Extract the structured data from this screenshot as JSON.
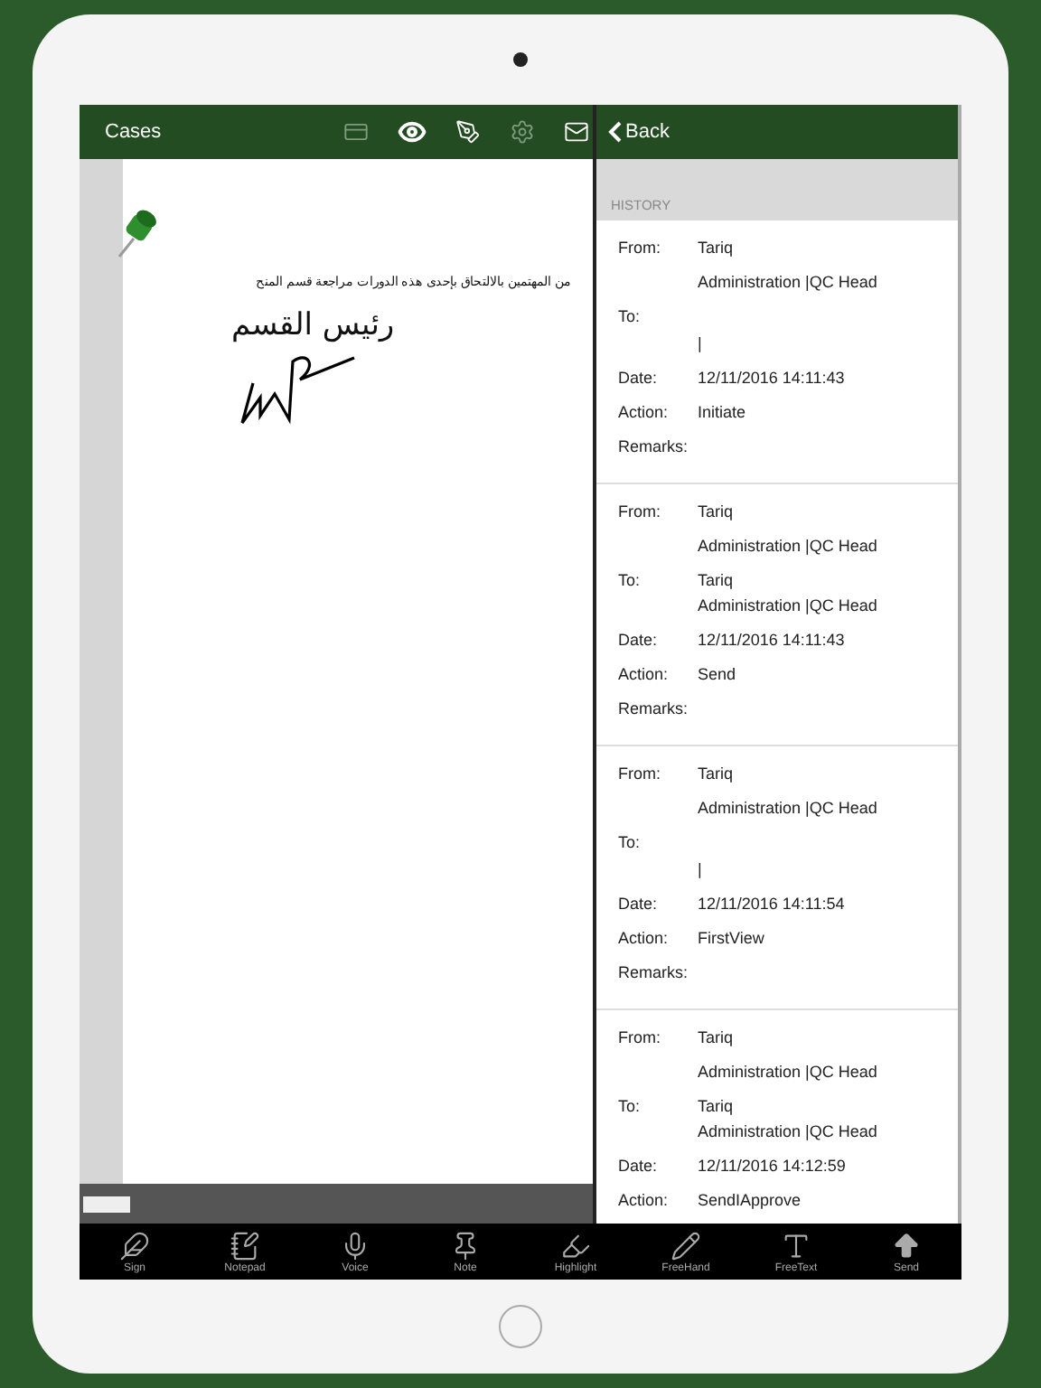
{
  "header": {
    "title": "Cases",
    "tools": [
      {
        "kind": "card",
        "disabled": true
      },
      {
        "kind": "eye",
        "disabled": false
      },
      {
        "kind": "pen",
        "disabled": false
      },
      {
        "kind": "gear",
        "disabled": true
      },
      {
        "kind": "mail",
        "disabled": false
      }
    ]
  },
  "document": {
    "lines": [
      {
        "kind": "small",
        "text": "من المهتمين بالالتحاق بإحدى هذه الدورات مراجعة قسم المنح"
      },
      {
        "kind": "large",
        "text": "رئيس القسم"
      }
    ]
  },
  "panel": {
    "back": "Back",
    "section": "HISTORY",
    "entries": [
      {
        "rows": [
          {
            "label": "From:",
            "kind": "inline",
            "lines": [
              "Tariq",
              "Administration |QC Head"
            ]
          },
          {
            "label": "To:",
            "kind": "below",
            "lines": [
              "|"
            ]
          },
          {
            "label": "Date:",
            "kind": "inline",
            "lines": [
              "12/11/2016 14:11:43"
            ]
          },
          {
            "label": "Action:",
            "kind": "inline",
            "lines": [
              "Initiate"
            ]
          },
          {
            "label": "Remarks:",
            "kind": "inline",
            "lines": []
          }
        ]
      },
      {
        "rows": [
          {
            "label": "From:",
            "kind": "inline",
            "lines": [
              "Tariq",
              "Administration |QC Head"
            ]
          },
          {
            "label": "To:",
            "kind": "tight",
            "lines": [
              "Tariq",
              "Administration |QC Head"
            ]
          },
          {
            "label": "Date:",
            "kind": "inline",
            "lines": [
              "12/11/2016 14:11:43"
            ]
          },
          {
            "label": "Action:",
            "kind": "inline",
            "lines": [
              "Send"
            ]
          },
          {
            "label": "Remarks:",
            "kind": "inline",
            "lines": []
          }
        ]
      },
      {
        "rows": [
          {
            "label": "From:",
            "kind": "inline",
            "lines": [
              "Tariq",
              "Administration |QC Head"
            ]
          },
          {
            "label": "To:",
            "kind": "below",
            "lines": [
              "|"
            ]
          },
          {
            "label": "Date:",
            "kind": "inline",
            "lines": [
              "12/11/2016 14:11:54"
            ]
          },
          {
            "label": "Action:",
            "kind": "inline",
            "lines": [
              "FirstView"
            ]
          },
          {
            "label": "Remarks:",
            "kind": "inline",
            "lines": []
          }
        ]
      },
      {
        "rows": [
          {
            "label": "From:",
            "kind": "inline",
            "lines": [
              "Tariq",
              "Administration |QC Head"
            ]
          },
          {
            "label": "To:",
            "kind": "tight",
            "lines": [
              "Tariq",
              "Administration |QC Head"
            ]
          },
          {
            "label": "Date:",
            "kind": "inline",
            "lines": [
              "12/11/2016 14:12:59"
            ]
          },
          {
            "label": "Action:",
            "kind": "inline",
            "lines": [
              "SendIApprove"
            ]
          }
        ]
      }
    ]
  },
  "toolbar": [
    {
      "kind": "sign",
      "label": "Sign"
    },
    {
      "kind": "notepad",
      "label": "Notepad"
    },
    {
      "kind": "voice",
      "label": "Voice"
    },
    {
      "kind": "note",
      "label": "Note"
    },
    {
      "kind": "highlight",
      "label": "Highlight"
    },
    {
      "kind": "freehand",
      "label": "FreeHand"
    },
    {
      "kind": "freetext",
      "label": "FreeText"
    },
    {
      "kind": "send",
      "label": "Send"
    }
  ]
}
